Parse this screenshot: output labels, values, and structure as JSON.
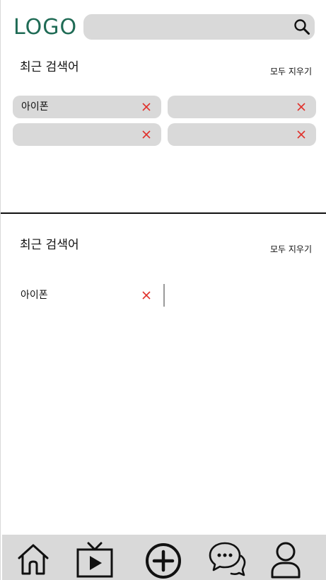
{
  "header": {
    "logo": "LOGO",
    "search": {
      "value": "",
      "placeholder": "",
      "icon": "search-icon"
    }
  },
  "recent_chips": {
    "title": "최근 검색어",
    "clear_all": "모두 지우기",
    "items": [
      {
        "label": "아이폰"
      },
      {
        "label": ""
      },
      {
        "label": ""
      },
      {
        "label": ""
      }
    ],
    "remove_icon": "close-icon"
  },
  "recent_list": {
    "title": "최근 검색어",
    "clear_all": "모두 지우기",
    "items": [
      {
        "label": "아이폰"
      }
    ],
    "remove_icon": "close-icon"
  },
  "bottom_nav": [
    {
      "icon": "home-icon"
    },
    {
      "icon": "tv-play-icon"
    },
    {
      "icon": "add-circle-icon"
    },
    {
      "icon": "chat-icon"
    },
    {
      "icon": "user-icon"
    }
  ],
  "colors": {
    "logo": "#1f6b55",
    "chip_bg": "#d9d9d9",
    "remove_x": "#e0312b",
    "nav_bg": "#d9d9d9"
  }
}
